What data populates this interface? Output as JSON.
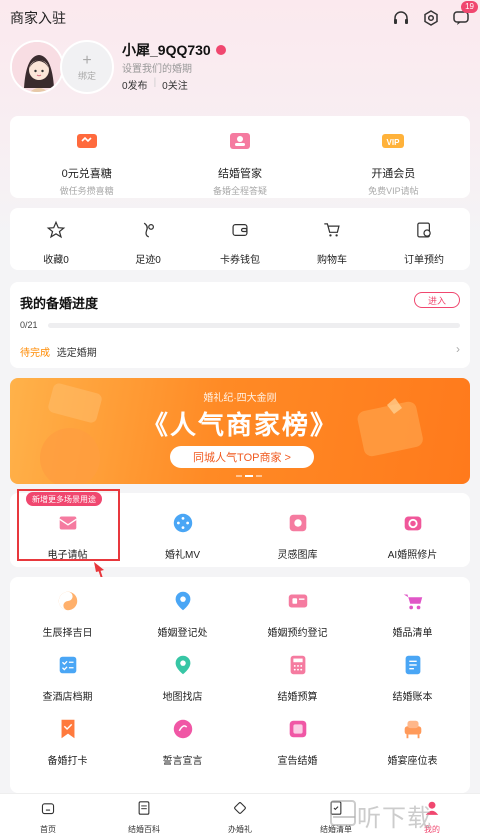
{
  "header": {
    "merchant_entry": "商家入驻",
    "message_badge": "19"
  },
  "profile": {
    "bind_label": "绑定",
    "username": "小犀_9QQ730",
    "set_wedding_date": "设置我们的婚期",
    "posts": "0发布",
    "following": "0关注"
  },
  "services": [
    {
      "title": "0元兑喜糖",
      "subtitle": "做任务攒喜糖",
      "icon": "candy-icon"
    },
    {
      "title": "结婚管家",
      "subtitle": "备婚全程答疑",
      "icon": "butler-icon"
    },
    {
      "title": "开通会员",
      "subtitle": "免费VIP请帖",
      "icon": "vip-icon"
    }
  ],
  "quick": [
    {
      "label": "收藏0",
      "icon": "star-icon"
    },
    {
      "label": "足迹0",
      "icon": "footprint-icon"
    },
    {
      "label": "卡券钱包",
      "icon": "wallet-icon"
    },
    {
      "label": "购物车",
      "icon": "cart-icon"
    },
    {
      "label": "订单预约",
      "icon": "order-icon"
    }
  ],
  "progress": {
    "title": "我的备婚进度",
    "enter": "进入",
    "count": "0/21",
    "fraction": 0,
    "pending_label": "待完成",
    "next_task": "选定婚期"
  },
  "banner": {
    "subtitle": "婚礼纪·四大金刚",
    "title": "《人气商家榜》",
    "button": "同城人气TOP商家 >"
  },
  "features": {
    "new_tag": "新增更多场景用途",
    "items": [
      {
        "label": "电子请帖",
        "icon": "invitation-icon"
      },
      {
        "label": "婚礼MV",
        "icon": "mv-icon"
      },
      {
        "label": "灵感图库",
        "icon": "gallery-icon"
      },
      {
        "label": "AI婚照修片",
        "icon": "ai-photo-icon"
      }
    ]
  },
  "tools": [
    {
      "label": "生辰择吉日",
      "icon": "yinyang-icon"
    },
    {
      "label": "婚姻登记处",
      "icon": "location-icon"
    },
    {
      "label": "婚姻预约登记",
      "icon": "booking-icon"
    },
    {
      "label": "婚品清单",
      "icon": "shopping-cart-icon"
    },
    {
      "label": "查酒店档期",
      "icon": "checklist-icon"
    },
    {
      "label": "地图找店",
      "icon": "map-pin-icon"
    },
    {
      "label": "结婚预算",
      "icon": "calculator-icon"
    },
    {
      "label": "结婚账本",
      "icon": "ledger-icon"
    },
    {
      "label": "备婚打卡",
      "icon": "checkin-icon"
    },
    {
      "label": "誓言宣言",
      "icon": "vow-icon"
    },
    {
      "label": "宣告结婚",
      "icon": "announce-icon"
    },
    {
      "label": "婚宴座位表",
      "icon": "seat-icon"
    }
  ],
  "tabbar": [
    {
      "label": "首页",
      "icon": "home-icon"
    },
    {
      "label": "结婚百科",
      "icon": "book-icon"
    },
    {
      "label": "办婚礼",
      "icon": "rings-icon"
    },
    {
      "label": "结婚清单",
      "icon": "list-icon"
    },
    {
      "label": "我的",
      "icon": "user-icon"
    }
  ],
  "watermark": "一听下载",
  "colors": {
    "accent": "#f0476f",
    "orange": "#ff8a25",
    "highlight": "#e8383d"
  }
}
